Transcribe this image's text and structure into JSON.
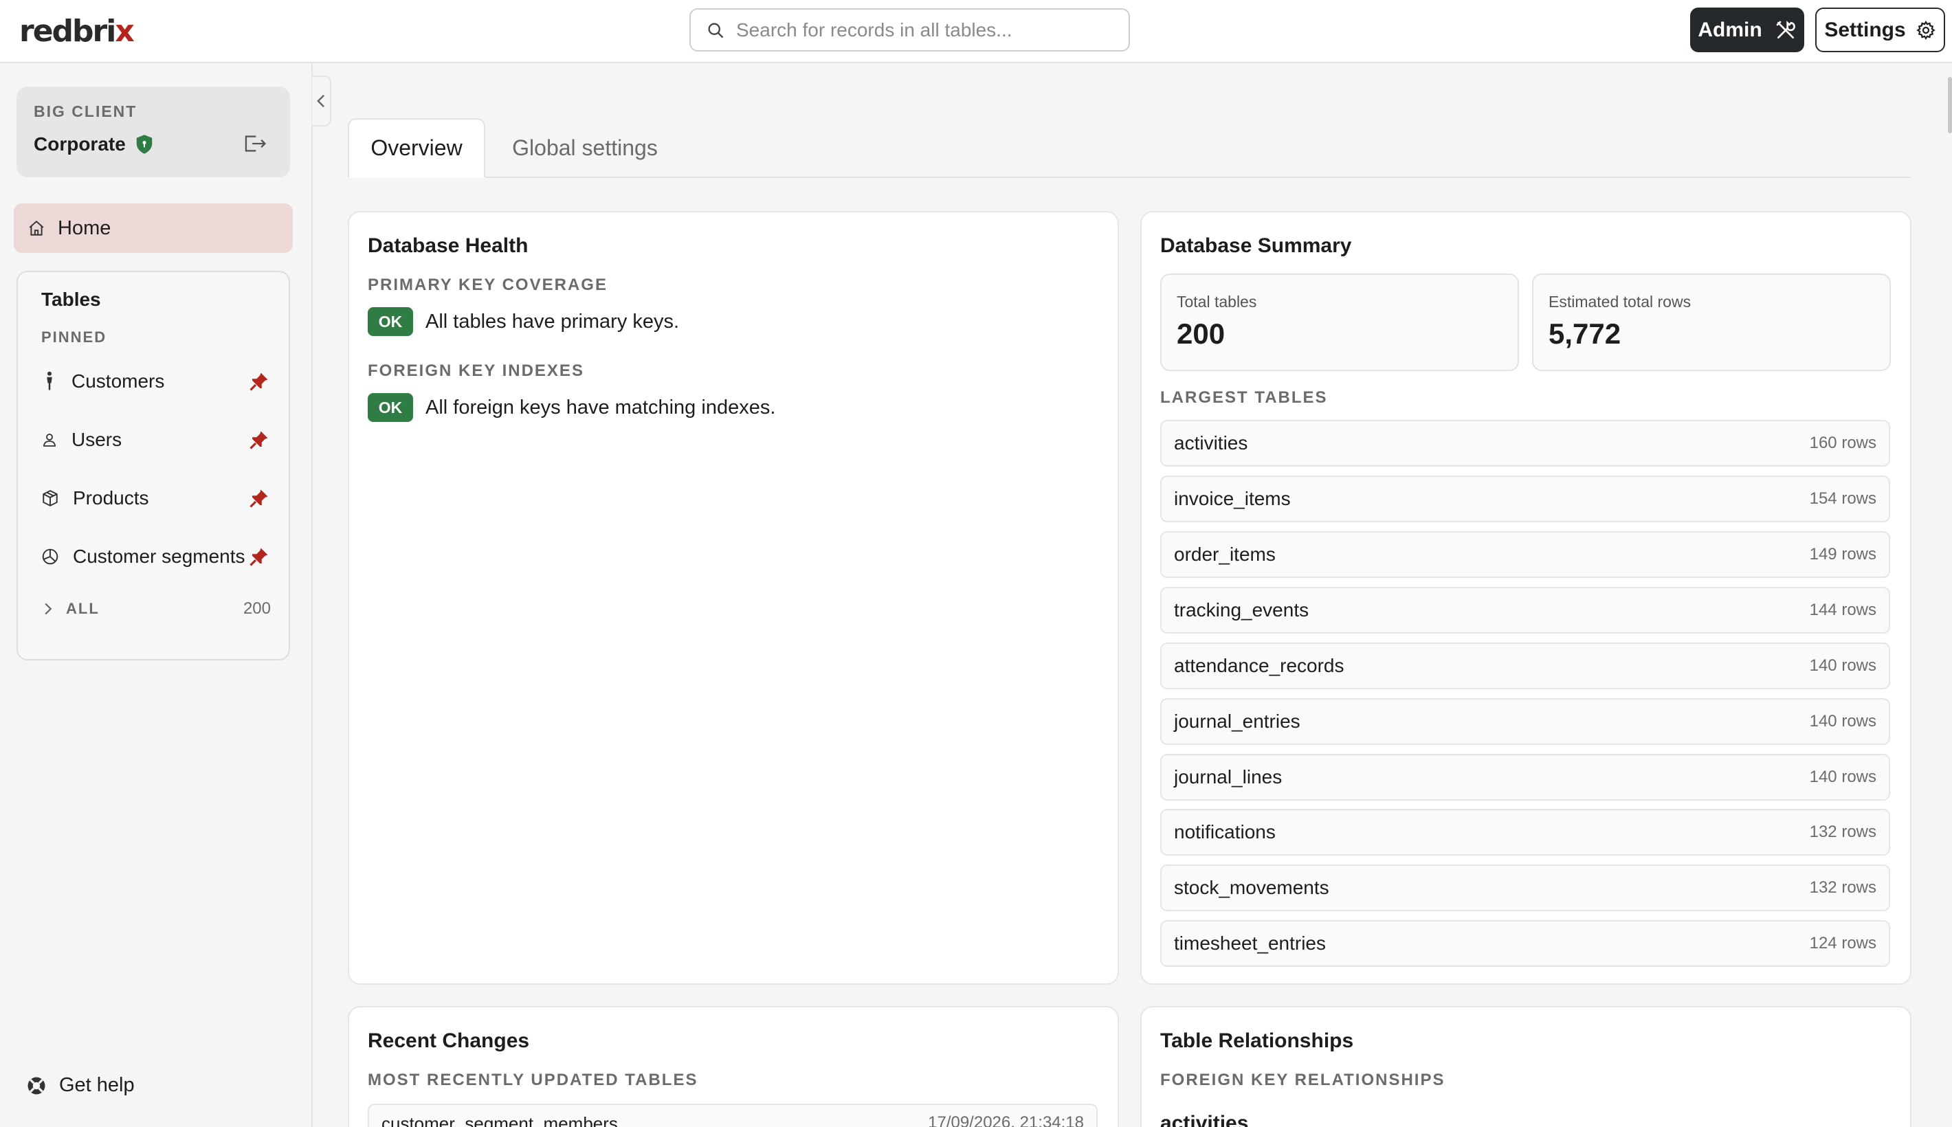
{
  "app": {
    "logo_main": "redbri",
    "logo_accent": "x",
    "search_placeholder": "Search for records in all tables...",
    "admin_label": "Admin",
    "settings_label": "Settings"
  },
  "sidebar": {
    "client_label": "BIG CLIENT",
    "client_name": "Corporate",
    "home_label": "Home",
    "tables_title": "Tables",
    "pinned_label": "PINNED",
    "pinned": [
      {
        "label": "Customers",
        "icon": "person-standing-icon"
      },
      {
        "label": "Users",
        "icon": "user-icon"
      },
      {
        "label": "Products",
        "icon": "box-icon"
      },
      {
        "label": "Customer segments",
        "icon": "pie-chart-icon"
      }
    ],
    "all_label": "ALL",
    "all_count": "200",
    "help_label": "Get help"
  },
  "tabs": {
    "overview": "Overview",
    "global_settings": "Global settings"
  },
  "health": {
    "title": "Database Health",
    "pk_label": "PRIMARY KEY COVERAGE",
    "pk_badge": "OK",
    "pk_text": "All tables have primary keys.",
    "fk_label": "FOREIGN KEY INDEXES",
    "fk_badge": "OK",
    "fk_text": "All foreign keys have matching indexes."
  },
  "summary": {
    "title": "Database Summary",
    "total_tables_label": "Total tables",
    "total_tables_value": "200",
    "total_rows_label": "Estimated total rows",
    "total_rows_value": "5,772",
    "largest_label": "LARGEST TABLES",
    "largest": [
      {
        "name": "activities",
        "rows": "160 rows"
      },
      {
        "name": "invoice_items",
        "rows": "154 rows"
      },
      {
        "name": "order_items",
        "rows": "149 rows"
      },
      {
        "name": "tracking_events",
        "rows": "144 rows"
      },
      {
        "name": "attendance_records",
        "rows": "140 rows"
      },
      {
        "name": "journal_entries",
        "rows": "140 rows"
      },
      {
        "name": "journal_lines",
        "rows": "140 rows"
      },
      {
        "name": "notifications",
        "rows": "132 rows"
      },
      {
        "name": "stock_movements",
        "rows": "132 rows"
      },
      {
        "name": "timesheet_entries",
        "rows": "124 rows"
      }
    ]
  },
  "recent": {
    "title": "Recent Changes",
    "label": "MOST RECENTLY UPDATED TABLES",
    "first_name": "customer_segment_members",
    "first_time": "17/09/2026, 21:34:18"
  },
  "relationships": {
    "title": "Table Relationships",
    "label": "FOREIGN KEY RELATIONSHIPS",
    "first_table": "activities"
  },
  "colors": {
    "brand_accent": "#b3261e",
    "ok_green": "#2f7d45",
    "pin_red": "#b3261e",
    "home_highlight": "#ecd9d7"
  }
}
